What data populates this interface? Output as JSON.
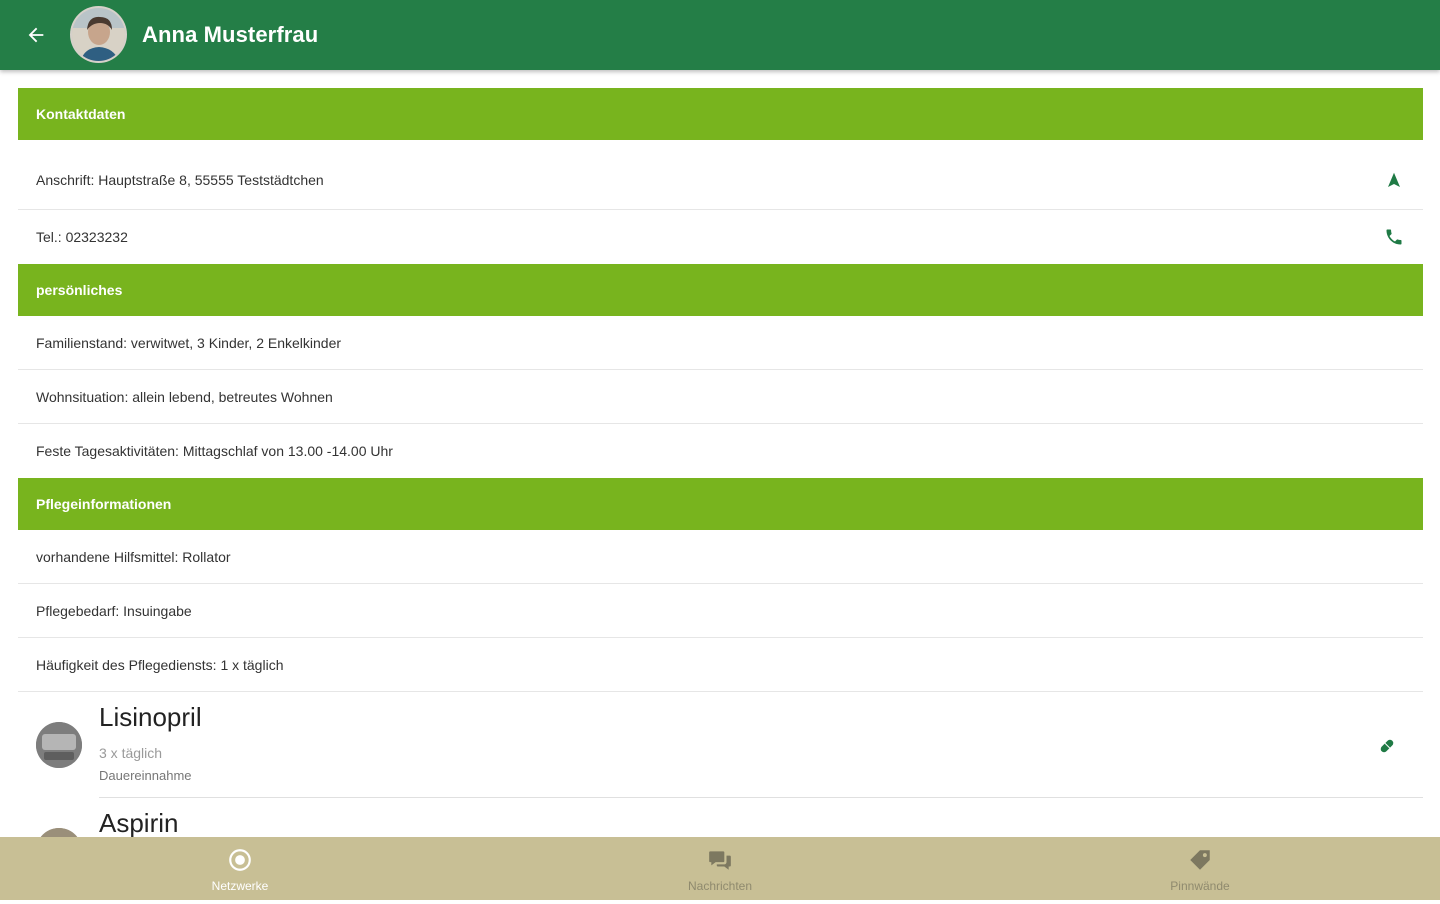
{
  "header": {
    "title": "Anna Musterfrau",
    "back_icon": "arrow-left-icon"
  },
  "colors": {
    "appbar": "#247e47",
    "section_header": "#78b41e",
    "bottom_nav": "#c8bf95",
    "icon_accent": "#1f7a45"
  },
  "sections": [
    {
      "title": "Kontaktdaten",
      "rows": [
        {
          "text": "Anschrift: Hauptstraße 8, 55555 Teststädtchen",
          "icon": "navigation-icon"
        },
        {
          "text": "Tel.: 02323232",
          "icon": "phone-icon"
        }
      ]
    },
    {
      "title": "persönliches",
      "rows": [
        {
          "text": "Familienstand: verwitwet, 3 Kinder, 2 Enkelkinder"
        },
        {
          "text": "Wohnsituation: allein lebend, betreutes Wohnen"
        },
        {
          "text": "Feste Tagesaktivitäten: Mittagschlaf von 13.00 -14.00 Uhr"
        }
      ]
    },
    {
      "title": "Pflegeinformationen",
      "rows": [
        {
          "text": "vorhandene Hilfsmittel: Rollator"
        },
        {
          "text": "Pflegebedarf: Insuingabe"
        },
        {
          "text": "Häufigkeit des Pflegediensts: 1 x täglich"
        }
      ]
    }
  ],
  "medications": [
    {
      "name": "Lisinopril",
      "frequency": "3 x täglich",
      "type": "Dauereinnahme",
      "icon": "pill-icon"
    },
    {
      "name": "Aspirin",
      "frequency": "",
      "type": "",
      "icon": "pill-icon"
    }
  ],
  "bottom_nav": [
    {
      "label": "Netzwerke",
      "icon": "radio-button-icon",
      "active": true
    },
    {
      "label": "Nachrichten",
      "icon": "chat-bubbles-icon",
      "active": false
    },
    {
      "label": "Pinnwände",
      "icon": "tag-icon",
      "active": false
    }
  ]
}
